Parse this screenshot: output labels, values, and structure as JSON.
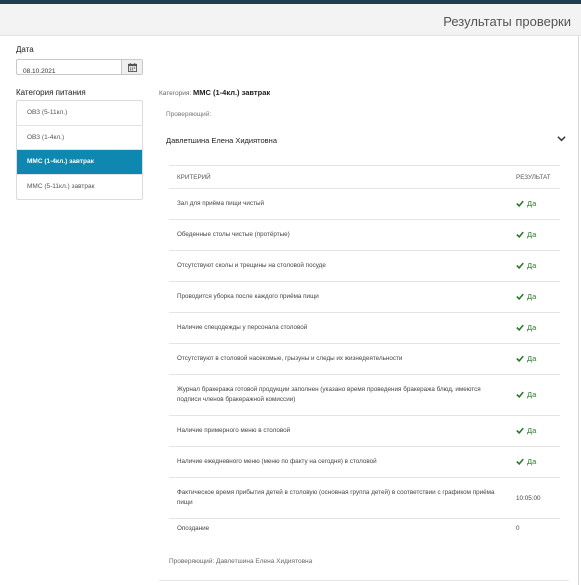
{
  "header": {
    "title": "Результаты проверки"
  },
  "filters": {
    "date_label": "Дата",
    "date_value": "08.10.2021",
    "category_label": "Категория питания",
    "categories": [
      {
        "label": "ОВЗ (5-11кл.)",
        "active": false
      },
      {
        "label": "ОВЗ (1-4кл.)",
        "active": false
      },
      {
        "label": "ММС (1-4кл.) завтрак",
        "active": true
      },
      {
        "label": "ММС (5-11кл.) завтрак",
        "active": false
      }
    ]
  },
  "main": {
    "category_prefix": "Категория:",
    "category_value": "ММС (1-4кл.) завтрак",
    "inspector_label": "Проверяющий:",
    "inspector_name": "Давлетшина Елена Хидиятовна",
    "table": {
      "col_criterion": "КРИТЕРИЙ",
      "col_result": "РЕЗУЛЬТАТ",
      "rows": [
        {
          "criterion": "Зал для приёма пищи чистый",
          "result": "Да"
        },
        {
          "criterion": "Обеденные столы чистые (протёртые)",
          "result": "Да"
        },
        {
          "criterion": "Отсутствуют сколы и трещины на столовой посуде",
          "result": "Да"
        },
        {
          "criterion": "Проводится уборка после каждого приёма пищи",
          "result": "Да"
        },
        {
          "criterion": "Наличие спецодежды у персонала столовой",
          "result": "Да"
        },
        {
          "criterion": "Отсутствуют в столовой насекомые, грызуны и следы их жизнедеятельности",
          "result": "Да"
        },
        {
          "criterion": "Журнал бракеража готовой продукции заполнен (указано время проведения бракеража блюд, имеются подписи членов бракеражной комиссии)",
          "result": "Да"
        },
        {
          "criterion": "Наличие примерного меню в столовой",
          "result": "Да"
        },
        {
          "criterion": "Наличие ежедневного меню (меню по факту на сегодня) в столовой",
          "result": "Да"
        },
        {
          "criterion": "Фактическое время прибытия детей в столовую (основная группа детей) в соответствии с графиком приёма пищи",
          "result": "10:05:00"
        },
        {
          "criterion": "Опоздание",
          "result": "0"
        }
      ]
    },
    "footer_inspector": "Проверяющий: Давлетшина Елена Хидиятовна"
  },
  "colors": {
    "accent": "#0e88b1",
    "topbar": "#1c3f4f",
    "yes": "#2d7a2d"
  },
  "icons": {
    "calendar": "calendar-icon",
    "chevron": "chevron-down-icon",
    "check": "check-icon"
  }
}
